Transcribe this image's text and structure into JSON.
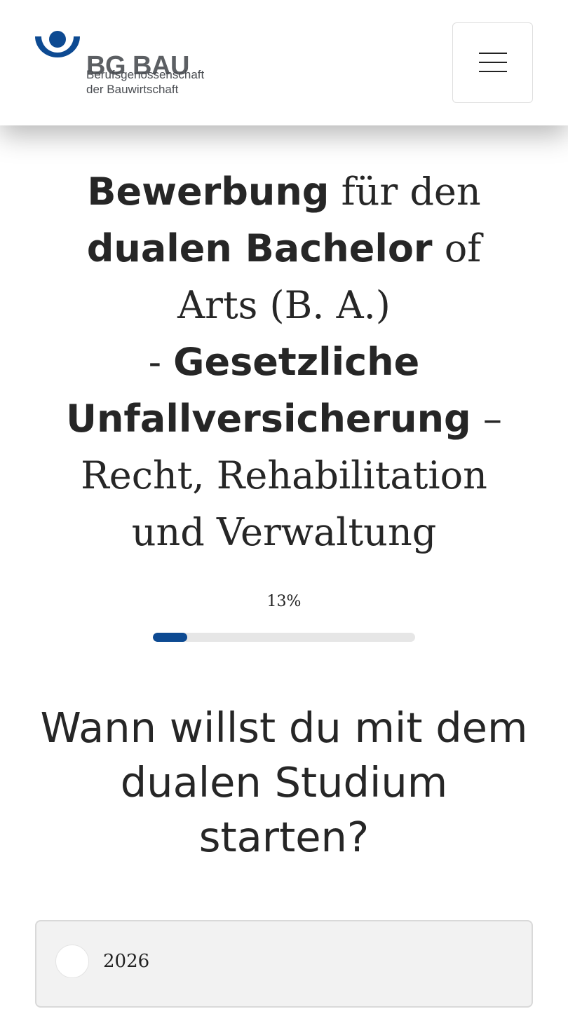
{
  "header": {
    "logo": {
      "name": "BG BAU",
      "subtitle_line1": "Berufsgenossenschaft",
      "subtitle_line2": "der Bauwirtschaft",
      "mark_color": "#0d4a92"
    },
    "menu_icon": "hamburger-menu-icon"
  },
  "title": {
    "line1_bold": "Bewerbung",
    "line1_rest": " für den",
    "line2_bold": "dualen Bachelor",
    "line2_rest": " of",
    "line3": "Arts (B. A.)",
    "line4_prefix": "- ",
    "line4_bold": "Gesetzliche",
    "line5_bold": "Unfallversicherung",
    "line5_rest": " –",
    "line6": "Recht, Rehabilitation",
    "line7": "und Verwaltung"
  },
  "progress": {
    "label": "13%",
    "value": 0.13,
    "fill_color": "#0d4a92",
    "track_color": "#e6e6e6"
  },
  "question": {
    "line1": "Wann willst du mit dem",
    "line2": "dualen Studium",
    "line3": "starten?"
  },
  "options": [
    {
      "label": "2026",
      "selected": false
    }
  ]
}
